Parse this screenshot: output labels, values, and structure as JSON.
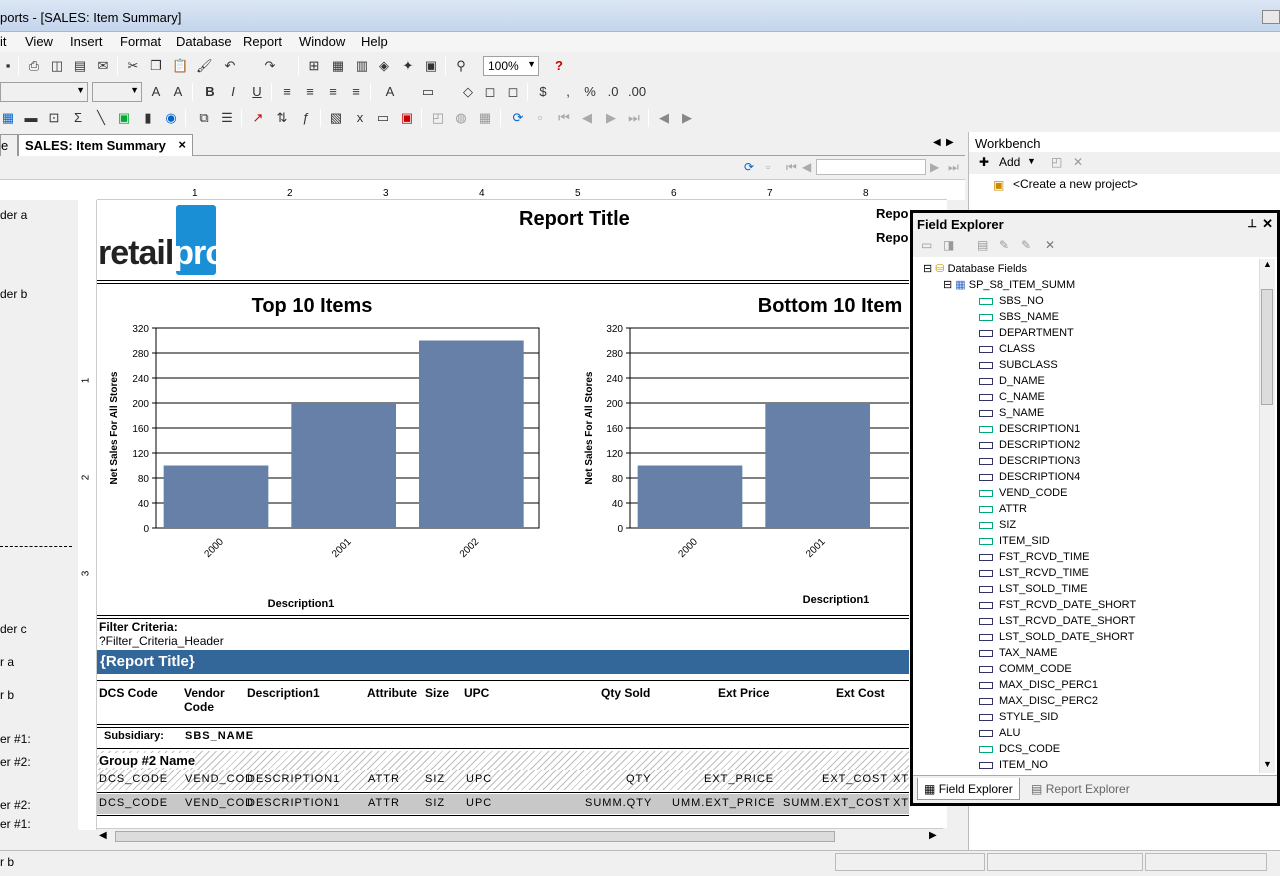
{
  "window": {
    "title": "ports - [SALES: Item Summary]"
  },
  "menu": [
    {
      "label": "it"
    },
    {
      "label": "View"
    },
    {
      "label": "Insert"
    },
    {
      "label": "Format"
    },
    {
      "label": "Database"
    },
    {
      "label": "Report"
    },
    {
      "label": "Window"
    },
    {
      "label": "Help"
    }
  ],
  "toolbar": {
    "zoom": "100%"
  },
  "doc_tabs": {
    "prev_tab": "e",
    "active_tab": "SALES: Item Summary",
    "close": "×"
  },
  "workbench": {
    "title": "Workbench",
    "add_label": "Add",
    "create_project": "<Create a new project>"
  },
  "sections": {
    "page_header_a": "der a",
    "page_header_b": "der b",
    "page_header_c": "der c",
    "report_header_a": "r a",
    "header_b": "r b",
    "group1": "er #1:",
    "group2": "er #2:",
    "group2_footer": "er #2:",
    "group1_footer": "er #1:",
    "footer_b": "r b"
  },
  "ruler": {
    "marks": [
      "1",
      "2",
      "3",
      "4",
      "5",
      "6",
      "7",
      "8"
    ],
    "vmarks": [
      "1",
      "2",
      "3"
    ]
  },
  "report": {
    "title": "Report Title",
    "title_right_1": "Repo",
    "title_right_2": "Repo",
    "logo_text_1": "retail",
    "logo_text_2": "pro",
    "filter_label": "Filter Criteria:",
    "filter_value": "?Filter_Criteria_Header",
    "band_title": "{Report Title}",
    "columns": [
      "DCS Code",
      "Vendor Code",
      "Description1",
      "Attribute",
      "Size",
      "UPC",
      "Qty Sold",
      "Ext Price",
      "Ext Cost"
    ],
    "subsidiary_label": "Subsidiary:",
    "subsidiary_field": "SBS_NAME",
    "group2_name": "Group #2 Name",
    "detail_fields": [
      "DCS_CODE",
      "VEND_COD",
      "DESCRIPTION1",
      "ATTR",
      "SIZ",
      "UPC",
      "QTY",
      "EXT_PRICE",
      "EXT_COST",
      "XT"
    ],
    "summary_fields": [
      "DCS_CODE",
      "VEND_COD",
      "DESCRIPTION1",
      "ATTR",
      "SIZ",
      "UPC",
      "SUMM.QTY",
      "UMM.EXT_PRICE",
      "SUMM.EXT_COST",
      "XT"
    ]
  },
  "chart_data": [
    {
      "type": "bar",
      "title": "Top 10 Items",
      "xlabel": "Description1",
      "ylabel": "Net Sales For All Stores",
      "categories": [
        "2000",
        "2001",
        "2002"
      ],
      "values": [
        100,
        200,
        300
      ],
      "ylim": [
        0,
        320
      ],
      "yticks": [
        "320",
        "280",
        "240",
        "200",
        "160",
        "120",
        "80",
        "40",
        "0"
      ],
      "color": "#6680a8"
    },
    {
      "type": "bar",
      "title": "Bottom 10 Item",
      "xlabel": "Description1",
      "ylabel": "Net Sales For All Stores",
      "categories": [
        "2000",
        "2001"
      ],
      "values": [
        100,
        200
      ],
      "ylim": [
        0,
        320
      ],
      "yticks": [
        "320",
        "280",
        "240",
        "200",
        "160",
        "120",
        "80",
        "40",
        "0"
      ],
      "color": "#6680a8"
    }
  ],
  "field_explorer": {
    "title": "Field Explorer",
    "root": "Database Fields",
    "table": "SP_S8_ITEM_SUMM",
    "fields": [
      {
        "name": "SBS_NO",
        "checked": true
      },
      {
        "name": "SBS_NAME",
        "checked": true
      },
      {
        "name": "DEPARTMENT",
        "checked": false
      },
      {
        "name": "CLASS",
        "checked": false
      },
      {
        "name": "SUBCLASS",
        "checked": false
      },
      {
        "name": "D_NAME",
        "checked": false
      },
      {
        "name": "C_NAME",
        "checked": false
      },
      {
        "name": "S_NAME",
        "checked": false
      },
      {
        "name": "DESCRIPTION1",
        "checked": true
      },
      {
        "name": "DESCRIPTION2",
        "checked": false
      },
      {
        "name": "DESCRIPTION3",
        "checked": false
      },
      {
        "name": "DESCRIPTION4",
        "checked": false
      },
      {
        "name": "VEND_CODE",
        "checked": true
      },
      {
        "name": "ATTR",
        "checked": true
      },
      {
        "name": "SIZ",
        "checked": true
      },
      {
        "name": "ITEM_SID",
        "checked": true
      },
      {
        "name": "FST_RCVD_TIME",
        "checked": false
      },
      {
        "name": "LST_RCVD_TIME",
        "checked": false
      },
      {
        "name": "LST_SOLD_TIME",
        "checked": false
      },
      {
        "name": "FST_RCVD_DATE_SHORT",
        "checked": false
      },
      {
        "name": "LST_RCVD_DATE_SHORT",
        "checked": false
      },
      {
        "name": "LST_SOLD_DATE_SHORT",
        "checked": false
      },
      {
        "name": "TAX_NAME",
        "checked": false
      },
      {
        "name": "COMM_CODE",
        "checked": false
      },
      {
        "name": "MAX_DISC_PERC1",
        "checked": false
      },
      {
        "name": "MAX_DISC_PERC2",
        "checked": false
      },
      {
        "name": "STYLE_SID",
        "checked": false
      },
      {
        "name": "ALU",
        "checked": false
      },
      {
        "name": "DCS_CODE",
        "checked": true
      },
      {
        "name": "ITEM_NO",
        "checked": false
      }
    ],
    "tabs": [
      "Field Explorer",
      "Report Explorer"
    ]
  }
}
